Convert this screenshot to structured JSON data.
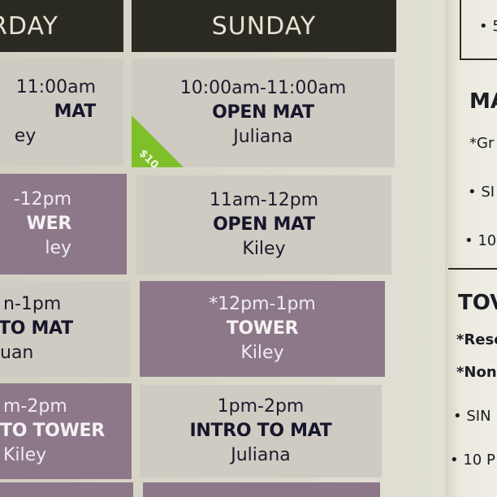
{
  "saturday": {
    "header": "RDAY",
    "rows": [
      {
        "time": "11:00am",
        "cls": "MAT",
        "inst": "ey"
      },
      {
        "time": "-12pm",
        "cls": "WER",
        "inst": "ley"
      },
      {
        "time": "n-1pm",
        "cls": "TO MAT",
        "inst": "uan"
      },
      {
        "time": "m-2pm",
        "cls": "TO TOWER",
        "inst": "Kiley"
      }
    ]
  },
  "sunday": {
    "header": "SUNDAY",
    "rows": [
      {
        "time": "10:00am-11:00am",
        "cls": "OPEN MAT",
        "inst": "Juliana",
        "price": "$10"
      },
      {
        "time": "11am-12pm",
        "cls": "OPEN MAT",
        "inst": "Kiley"
      },
      {
        "time": "*12pm-1pm",
        "cls": "TOWER",
        "inst": "Kiley"
      },
      {
        "time": "1pm-2pm",
        "cls": "INTRO TO MAT",
        "inst": "Juliana"
      }
    ]
  },
  "legend": {
    "box_text": "• 5",
    "heading1": "MA",
    "items1": [
      "*Gr",
      "• SI",
      "• 10"
    ],
    "heading2": "TOV",
    "items2": [
      "*Rese",
      "*Non-",
      "• SIN",
      "• 10 P"
    ]
  },
  "colors": {
    "header_bg": "#2b2a22",
    "light_cell": "#cfcbc3",
    "dark_cell": "#8c7889",
    "price_tag": "#7fbf2a"
  }
}
